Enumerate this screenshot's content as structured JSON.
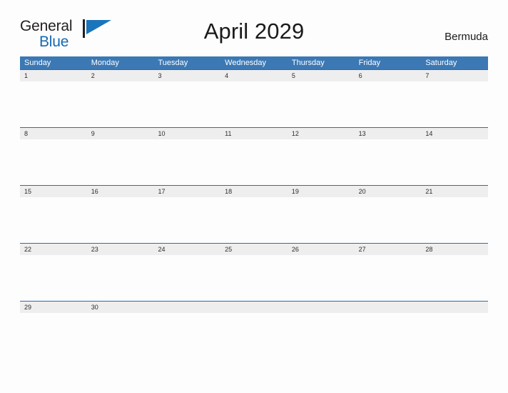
{
  "brand": {
    "name_part1": "General",
    "name_part2": "Blue",
    "flag_icon": "flag-icon",
    "color_dark": "#231f20",
    "color_blue": "#1569b0"
  },
  "header": {
    "title": "April 2029",
    "month": "April",
    "year": "2029",
    "country": "Bermuda"
  },
  "theme": {
    "header_blue": "#3b78b4",
    "row_divider_blue": "#2d6ca8",
    "date_band_gray": "#eeeeee",
    "page_background": "#fdfdfe",
    "text_dark": "#1a1a1a"
  },
  "calendar": {
    "weekdays": [
      "Sunday",
      "Monday",
      "Tuesday",
      "Wednesday",
      "Thursday",
      "Friday",
      "Saturday"
    ],
    "weeks": [
      {
        "days": [
          "1",
          "2",
          "3",
          "4",
          "5",
          "6",
          "7"
        ]
      },
      {
        "days": [
          "8",
          "9",
          "10",
          "11",
          "12",
          "13",
          "14"
        ]
      },
      {
        "days": [
          "15",
          "16",
          "17",
          "18",
          "19",
          "20",
          "21"
        ]
      },
      {
        "days": [
          "22",
          "23",
          "24",
          "25",
          "26",
          "27",
          "28"
        ]
      },
      {
        "days": [
          "29",
          "30",
          "",
          "",
          "",
          "",
          ""
        ]
      }
    ]
  }
}
